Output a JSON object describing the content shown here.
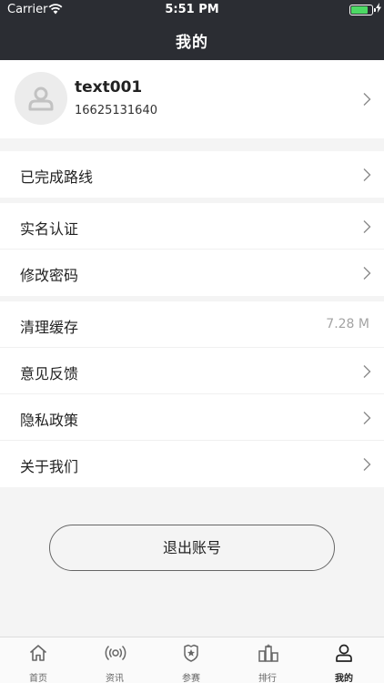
{
  "status_bar": {
    "carrier": "Carrier",
    "time": "5:51 PM",
    "battery_level": 0.85
  },
  "nav": {
    "title": "我的"
  },
  "profile": {
    "username": "text001",
    "phone": "16625131640"
  },
  "menu_groups": [
    {
      "items": [
        {
          "label": "已完成路线",
          "icon": "chevron-right-icon"
        }
      ]
    },
    {
      "items": [
        {
          "label": "实名认证",
          "icon": "chevron-right-icon"
        },
        {
          "label": "修改密码",
          "icon": "chevron-right-icon"
        }
      ]
    },
    {
      "items": [
        {
          "label": "清理缓存",
          "value": "7.28 M"
        },
        {
          "label": "意见反馈",
          "icon": "chevron-right-icon"
        },
        {
          "label": "隐私政策",
          "icon": "chevron-right-icon"
        },
        {
          "label": "关于我们",
          "icon": "chevron-right-icon"
        }
      ]
    }
  ],
  "logout": {
    "label": "退出账号"
  },
  "tabbar": {
    "active_index": 4,
    "tabs": [
      {
        "label": "首页",
        "icon": "home-icon"
      },
      {
        "label": "资讯",
        "icon": "broadcast-icon"
      },
      {
        "label": "参赛",
        "icon": "badge-icon"
      },
      {
        "label": "排行",
        "icon": "ranking-icon"
      },
      {
        "label": "我的",
        "icon": "user-icon"
      }
    ]
  },
  "colors": {
    "header_bg": "#2b2d33",
    "page_bg": "#f4f4f4",
    "battery_green": "#4cd964",
    "muted_text": "#a3a3a3"
  }
}
